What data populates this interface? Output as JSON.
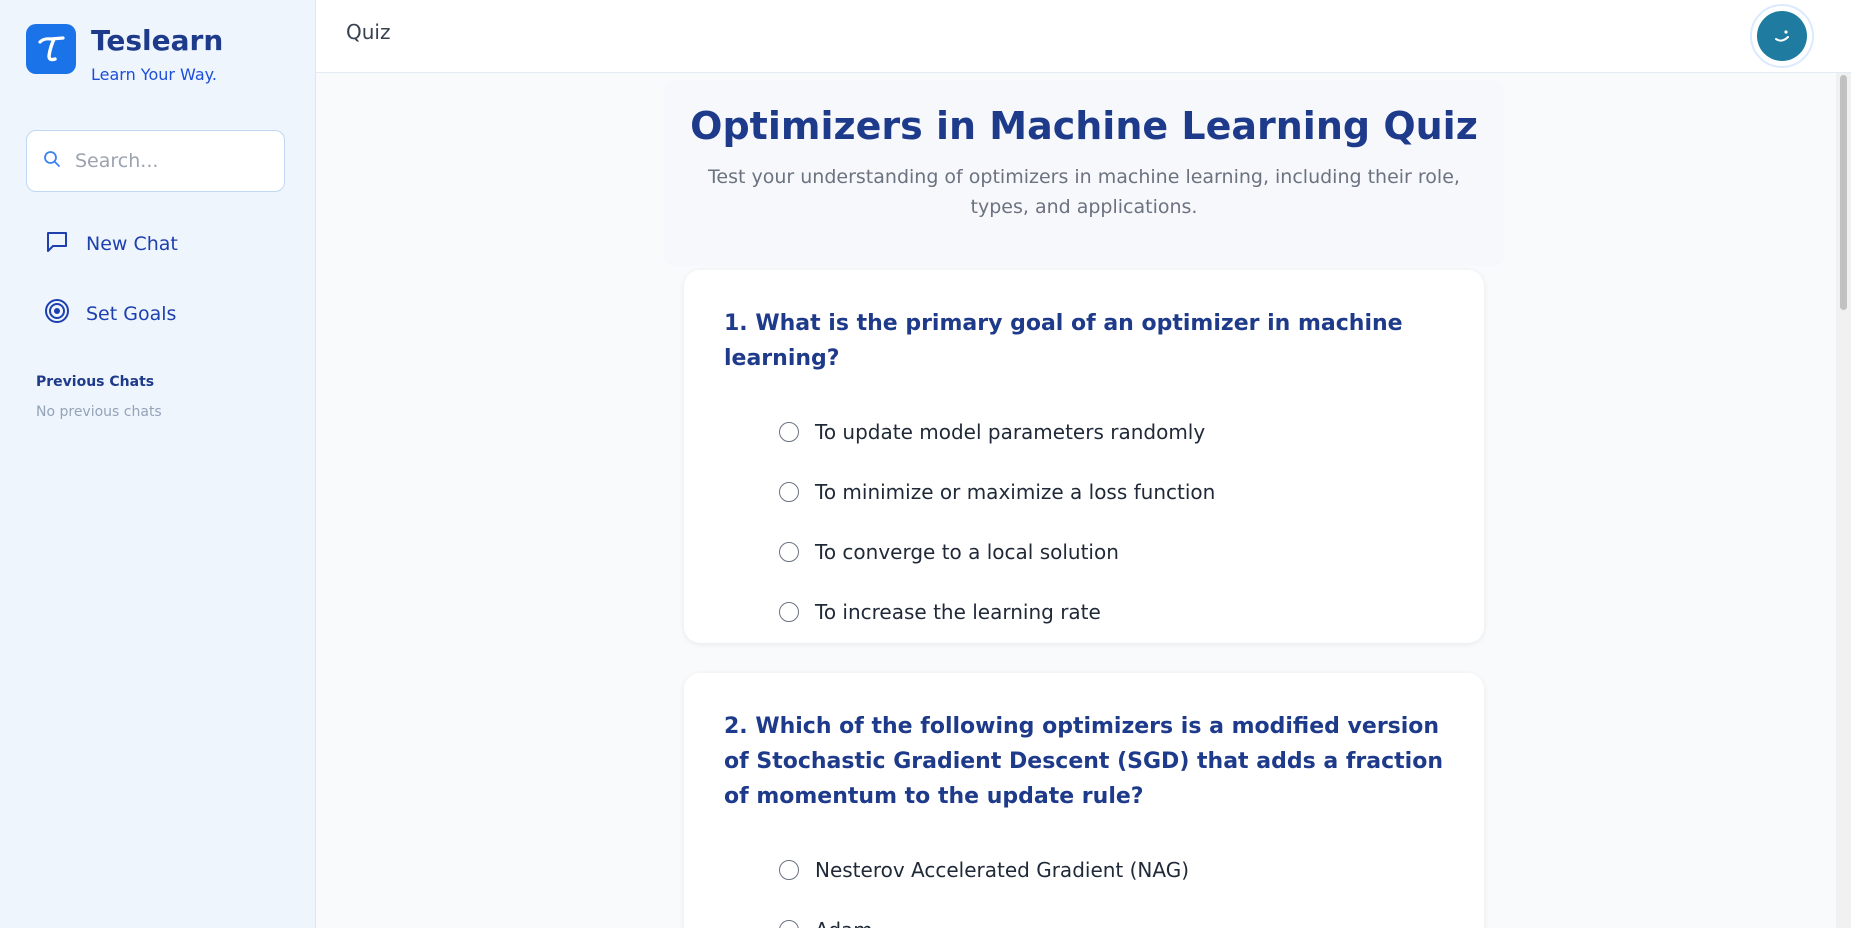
{
  "brand": {
    "name": "Teslearn",
    "tagline": "Learn Your Way."
  },
  "search": {
    "placeholder": "Search..."
  },
  "nav": [
    {
      "label": "New Chat",
      "icon": "chat-bubble-icon"
    },
    {
      "label": "Set Goals",
      "icon": "target-icon"
    }
  ],
  "previous_chats": {
    "title": "Previous Chats",
    "empty_text": "No previous chats"
  },
  "header": {
    "title": "Quiz"
  },
  "quiz": {
    "title": "Optimizers in Machine Learning Quiz",
    "description": "Test your understanding of optimizers in machine learning, including their role, types, and applications.",
    "questions": [
      {
        "text": "1. What is the primary goal of an optimizer in machine learning?",
        "options": [
          "To update model parameters randomly",
          "To minimize or maximize a loss function",
          "To converge to a local solution",
          "To increase the learning rate"
        ]
      },
      {
        "text": "2. Which of the following optimizers is a modified version of Stochastic Gradient Descent (SGD) that adds a fraction of momentum to the update rule?",
        "options": [
          "Nesterov Accelerated Gradient (NAG)",
          "Adam"
        ]
      }
    ]
  },
  "colors": {
    "accent": "#1a73e8",
    "title": "#1e3a8a",
    "sidebar_bg": "#eef5fd",
    "avatar_bg": "#1f7b9f"
  }
}
